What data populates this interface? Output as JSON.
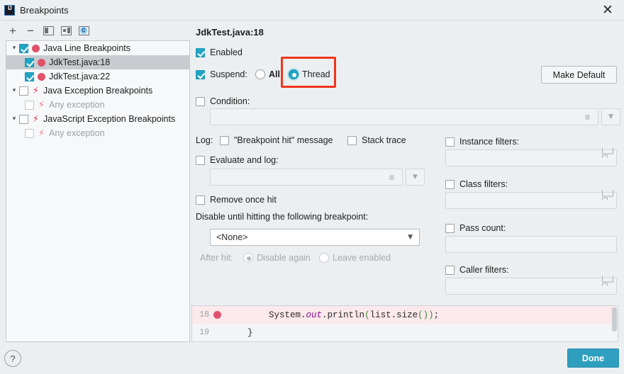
{
  "window": {
    "title": "Breakpoints",
    "app_icon": "intellij-idea-icon",
    "close_icon": "✕"
  },
  "toolbar": {
    "add_icon": "+",
    "remove_icon": "−",
    "group_icon": "move-to-group-icon",
    "edit_icon": "edit-description-icon",
    "c_icon": "C"
  },
  "tree": {
    "items": [
      {
        "label": "Java Line Breakpoints",
        "checked": true,
        "icon": "breakpoint-dot",
        "level": 0,
        "expanded": true,
        "selected": false,
        "disabled": false
      },
      {
        "label": "JdkTest.java:18",
        "checked": true,
        "icon": "breakpoint-dot",
        "level": 1,
        "expanded": null,
        "selected": true,
        "disabled": false
      },
      {
        "label": "JdkTest.java:22",
        "checked": true,
        "icon": "breakpoint-dot",
        "level": 1,
        "expanded": null,
        "selected": false,
        "disabled": false
      },
      {
        "label": "Java Exception Breakpoints",
        "checked": false,
        "icon": "exception-bolt",
        "level": 0,
        "expanded": true,
        "selected": false,
        "disabled": false
      },
      {
        "label": "Any exception",
        "checked": false,
        "icon": "exception-bolt",
        "level": 1,
        "expanded": null,
        "selected": false,
        "disabled": true
      },
      {
        "label": "JavaScript Exception Breakpoints",
        "checked": false,
        "icon": "exception-bolt",
        "level": 0,
        "expanded": true,
        "selected": false,
        "disabled": false
      },
      {
        "label": "Any exception",
        "checked": false,
        "icon": "exception-bolt",
        "level": 1,
        "expanded": null,
        "selected": false,
        "disabled": true
      }
    ]
  },
  "details": {
    "title": "JdkTest.java:18",
    "enabled_label": "Enabled",
    "enabled_checked": true,
    "suspend_label": "Suspend:",
    "suspend_checked": true,
    "suspend_options": [
      {
        "label": "All",
        "selected": false
      },
      {
        "label": "Thread",
        "selected": true
      }
    ],
    "make_default_label": "Make Default",
    "condition_label": "Condition:",
    "condition_checked": false,
    "condition_value": "",
    "log_label": "Log:",
    "log_message_label": "\"Breakpoint hit\" message",
    "log_message_checked": false,
    "stack_trace_label": "Stack trace",
    "stack_trace_checked": false,
    "evaluate_log_label": "Evaluate and log:",
    "evaluate_log_checked": false,
    "evaluate_log_value": "",
    "remove_once_hit_label": "Remove once hit",
    "remove_once_hit_checked": false,
    "disable_until_label": "Disable until hitting the following breakpoint:",
    "disable_until_value": "<None>",
    "after_hit_label": "After hit:",
    "after_hit_options": [
      {
        "label": "Disable again",
        "selected": true
      },
      {
        "label": "Leave enabled",
        "selected": false
      }
    ],
    "filters": [
      {
        "label": "Instance filters:",
        "checked": false,
        "value": "",
        "browse": true
      },
      {
        "label": "Class filters:",
        "checked": false,
        "value": "",
        "browse": true
      },
      {
        "label": "Pass count:",
        "checked": false,
        "value": "",
        "browse": false
      },
      {
        "label": "Caller filters:",
        "checked": false,
        "value": "",
        "browse": true
      }
    ]
  },
  "annotation": {
    "color": "#f0361b",
    "target": "thread-radio"
  },
  "code_preview": {
    "lines": [
      {
        "number": "18",
        "breakpoint": true,
        "indent": "        ",
        "prefix": "System.",
        "field": "out",
        "mid": ".println",
        "open": "(",
        "body": "list.size",
        "inner": "()",
        "close": ")",
        "tail": ";"
      },
      {
        "number": "19",
        "breakpoint": false,
        "text": "    }"
      }
    ]
  },
  "footer": {
    "help_label": "?",
    "done_label": "Done"
  },
  "colors": {
    "accent": "#21a4c4",
    "done_button": "#2f9fc0",
    "breakpoint_red": "#e0536a",
    "annotation_red": "#f0361b",
    "dialog_bg": "#eceff1"
  }
}
